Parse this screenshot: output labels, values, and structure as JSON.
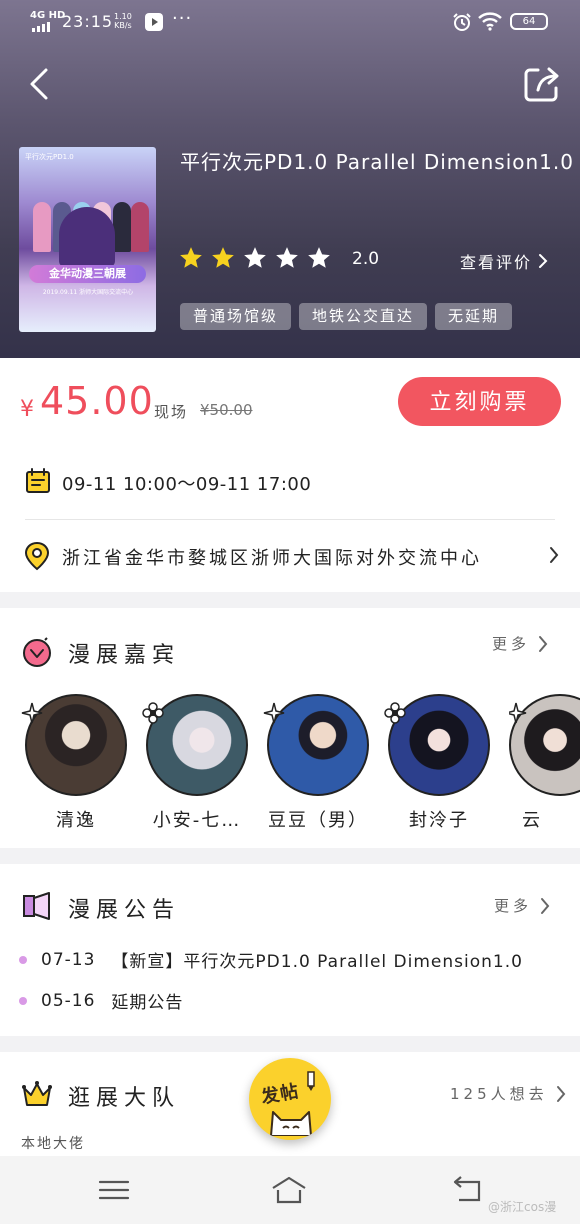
{
  "status_bar": {
    "signal": "4G HD",
    "time": "23:15",
    "net_speed_value": "1.10",
    "net_speed_unit": "KB/s",
    "more": "···",
    "battery": "64"
  },
  "event": {
    "title": "平行次元PD1.0 Parallel Dimension1.0",
    "poster_top_text": "平行次元PD1.0",
    "poster_banner": "金华动漫三朝展",
    "poster_sub": "2019.09.11 浙师大国际交流中心",
    "rating_value": "2.0",
    "rating": 2,
    "rating_max": 5,
    "reviews_link": "查看评价",
    "tags": [
      "普通场馆级",
      "地铁公交直达",
      "无延期"
    ]
  },
  "price": {
    "currency": "¥",
    "current": "45.00",
    "label": "现场",
    "original": "¥50.00",
    "buy_button": "立刻购票"
  },
  "schedule": {
    "datetime": "09-11 10:00～09-11 17:00"
  },
  "venue": {
    "address": "浙江省金华市婺城区浙师大国际对外交流中心"
  },
  "guests": {
    "title": "漫展嘉宾",
    "more": "更多",
    "items": [
      {
        "name": "清逸"
      },
      {
        "name": "小安-七…"
      },
      {
        "name": "豆豆（男）"
      },
      {
        "name": "封泠子"
      },
      {
        "name": "云"
      }
    ]
  },
  "notices": {
    "title": "漫展公告",
    "more": "更多",
    "items": [
      {
        "date": "07-13",
        "text": "【新宣】平行次元PD1.0 Parallel Dimension1.0"
      },
      {
        "date": "05-16",
        "text": "延期公告"
      }
    ]
  },
  "team": {
    "title": "逛展大队",
    "count_text": "125人想去",
    "subtitle": "本地大佬"
  },
  "fab": {
    "label": "发帖"
  },
  "watermark": "@浙江cos漫",
  "colors": {
    "accent": "#f25660",
    "star_on": "#f7d21f",
    "star_off": "#ffffff",
    "dot": "#d99ae6"
  }
}
